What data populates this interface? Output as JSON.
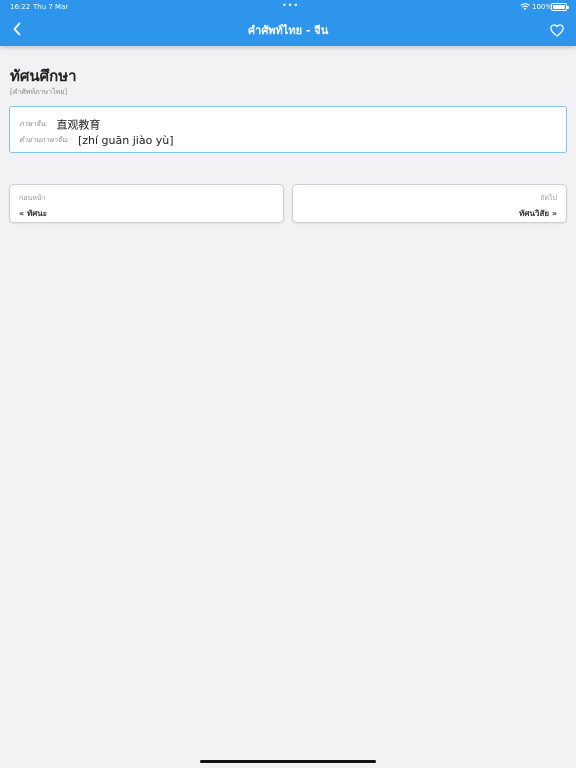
{
  "status_bar": {
    "time": "16:22",
    "date": "Thu 7 Mar",
    "dots": "•••",
    "battery": "100%"
  },
  "header": {
    "title": "คำศัพท์ไทย - จีน",
    "back_icon": "chevron-left-icon",
    "favorite_icon": "heart-icon"
  },
  "word": {
    "title": "ทัศนศึกษา",
    "subtitle": "[คำศัพท์ภาษาไทย]"
  },
  "translation": {
    "chinese_label": "ภาษาจีน:",
    "chinese_value": "直观教育",
    "pinyin_label": "คำอ่านภาษาจีน:",
    "pinyin_value": "[zhí guān jiào yù]"
  },
  "navigation": {
    "prev_label": "ก่อนหน้า",
    "prev_word": "« ทัศนะ",
    "next_label": "ถัดไป",
    "next_word": "ทัศนวิสัย »"
  },
  "colors": {
    "header": "#2d96ec",
    "accent_border": "#7cc6ee",
    "background": "#f2f2f4"
  }
}
